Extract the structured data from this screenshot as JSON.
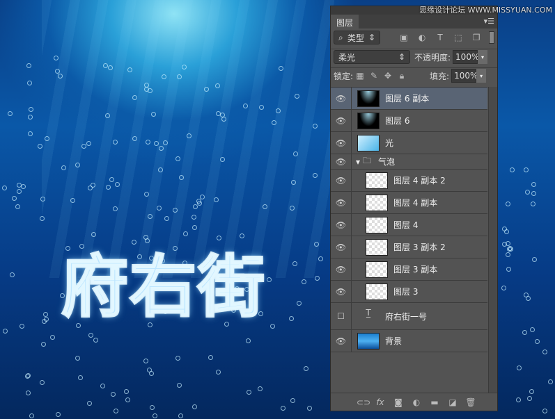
{
  "watermark": "思缘设计论坛 WWW.MISSYUAN.COM",
  "canvas": {
    "artwork_text": "府右街"
  },
  "panel": {
    "tab": "图层",
    "filter": {
      "kind": "类型",
      "icons": [
        "image-filter-icon",
        "adjustment-filter-icon",
        "type-filter-icon",
        "shape-filter-icon",
        "smart-object-filter-icon"
      ]
    },
    "blend_mode": "柔光",
    "opacity_label": "不透明度:",
    "opacity": "100%",
    "lock_label": "锁定:",
    "fill_label": "填充:",
    "fill": "100%",
    "layers": [
      {
        "name": "图层 6 副本",
        "visible": true,
        "thumb": "black",
        "selected": true
      },
      {
        "name": "图层 6",
        "visible": true,
        "thumb": "black"
      },
      {
        "name": "光",
        "visible": true,
        "thumb": "light"
      },
      {
        "name": "气泡",
        "visible": true,
        "group": true
      },
      {
        "name": "图层 4 副本 2",
        "visible": true,
        "thumb": "empty",
        "indent": true
      },
      {
        "name": "图层 4 副本",
        "visible": true,
        "thumb": "empty",
        "indent": true
      },
      {
        "name": "图层 4",
        "visible": true,
        "thumb": "empty",
        "indent": true
      },
      {
        "name": "图层 3 副本 2",
        "visible": true,
        "thumb": "empty",
        "indent": true
      },
      {
        "name": "图层 3 副本",
        "visible": true,
        "thumb": "empty",
        "indent": true
      },
      {
        "name": "图层 3",
        "visible": true,
        "thumb": "empty",
        "indent": true
      },
      {
        "name": "府右街一号",
        "visible": false,
        "thumb": "type"
      },
      {
        "name": "背景",
        "visible": true,
        "thumb": "water"
      }
    ],
    "bottom_icons": [
      "link-layers-icon",
      "fx-icon",
      "add-mask-icon",
      "adjustment-layer-icon",
      "new-group-icon",
      "new-layer-icon",
      "delete-icon"
    ]
  }
}
